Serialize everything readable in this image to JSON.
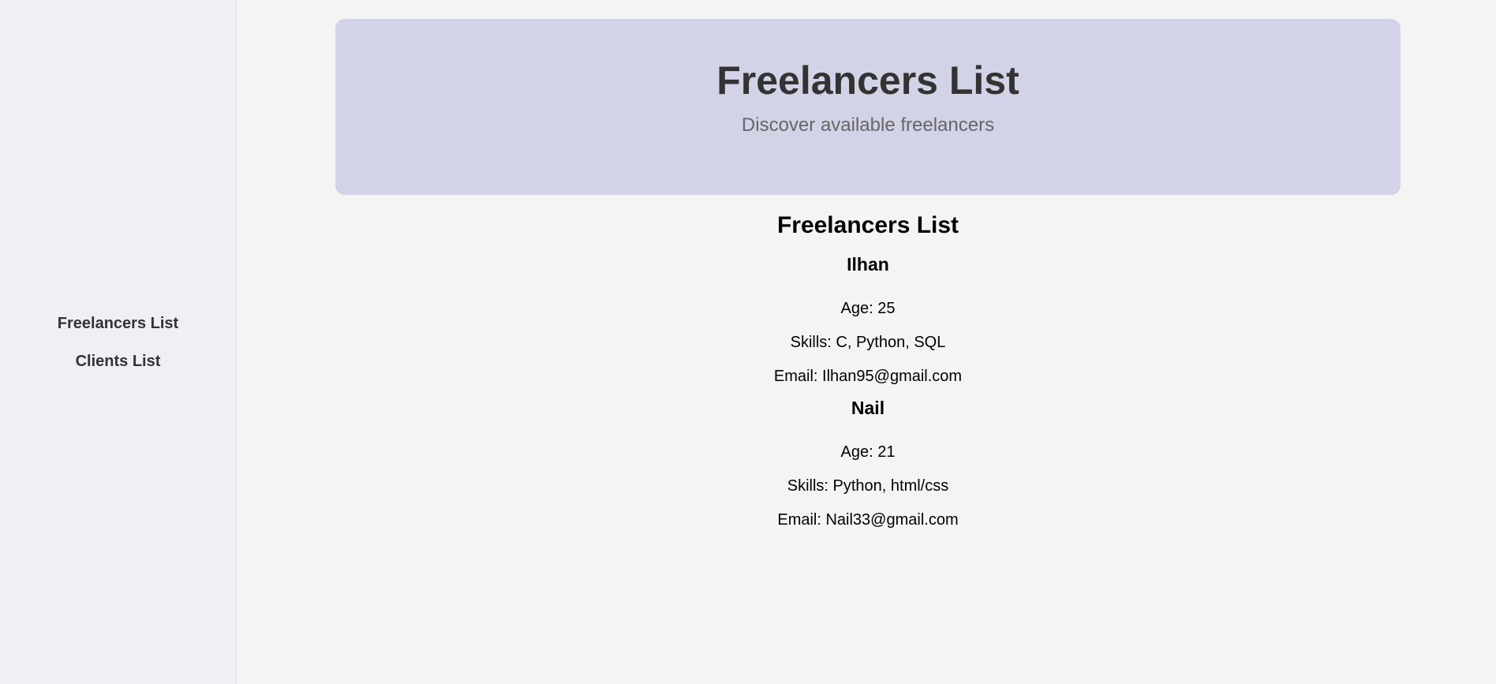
{
  "sidebar": {
    "items": [
      {
        "label": "Freelancers List"
      },
      {
        "label": "Clients List"
      }
    ]
  },
  "hero": {
    "title": "Freelancers List",
    "subtitle": "Discover available freelancers"
  },
  "section": {
    "title": "Freelancers List"
  },
  "freelancers": [
    {
      "name": "Ilhan",
      "age": "Age: 25",
      "skills": "Skills: C, Python, SQL",
      "email": "Email: Ilhan95@gmail.com"
    },
    {
      "name": "Nail",
      "age": "Age: 21",
      "skills": "Skills: Python, html/css",
      "email": "Email: Nail33@gmail.com"
    }
  ],
  "colors": {
    "hero_background": "#d3d3e7",
    "sidebar_background": "#f0eff5",
    "page_background": "#f4f4f4"
  }
}
